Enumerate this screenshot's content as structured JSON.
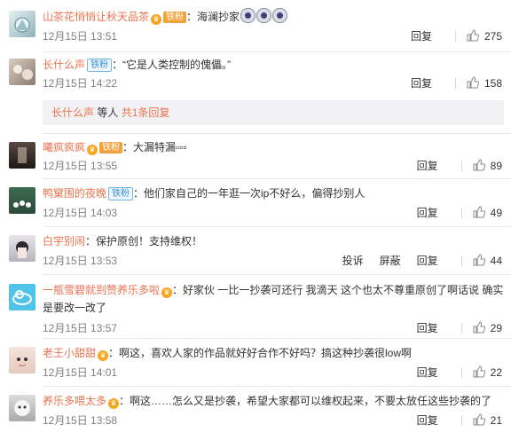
{
  "comments": [
    {
      "user": "山茶花悄悄让秋天品茶",
      "vip": "铁粉",
      "text": "：海澜抄家",
      "emoji": [
        "smiley-emoji",
        "smiley-emoji",
        "smiley-emoji"
      ],
      "time": "12月15日 13:51",
      "reply_label": "回复",
      "likes": "275"
    },
    {
      "user": "长什么声",
      "badge": "铁粉",
      "text": "：“它是人类控制的傀儡。”",
      "time": "12月15日 14:22",
      "reply_label": "回复",
      "likes": "158",
      "more_user": "长什么声",
      "more_text": " 等人 ",
      "more_count": "共1条回复"
    },
    {
      "user": "曦疯疯疯",
      "vip": "铁粉",
      "text": "：大漏特漏▫▫▫",
      "time": "12月15日 13:55",
      "reply_label": "回复",
      "likes": "89"
    },
    {
      "user": "鸭窠围的夜晚",
      "badge": "铁粉",
      "text": "：他们家自己的一年逛一次ip不好么，偏得抄别人",
      "time": "12月15日 14:03",
      "reply_label": "回复",
      "likes": "49"
    },
    {
      "user": "白宇别闹",
      "text": "：保护原创！支持维权！",
      "time": "12月15日 13:53",
      "report_label": "投诉",
      "block_label": "屏蔽",
      "reply_label": "回复",
      "likes": "44"
    },
    {
      "user": "一瓶雪碧就到赞养乐多啦",
      "text": "：好家伙 一比一抄袭可还行 我滴天 这个也太不尊重原创了啊话说 确实是要改一改了",
      "time": "12月15日 13:57",
      "reply_label": "回复",
      "likes": "29"
    },
    {
      "user": "老王小甜甜",
      "text": "：啊这，喜欢人家的作品就好好合作不好吗？搞这种抄袭很low啊",
      "time": "12月15日 14:01",
      "reply_label": "回复",
      "likes": "22"
    },
    {
      "user": "养乐多喂太多",
      "text": "：啊这……怎么又是抄袭，希望大家都可以维权起来，不要太放任这些抄袭的了",
      "time": "12月15日 13:58",
      "reply_label": "回复",
      "likes": "21"
    }
  ],
  "colors": {
    "username": "#eb7350",
    "badge_blue": "#3b8ed1",
    "vip_orange": "#f1a23a",
    "meta_gray": "#808080"
  },
  "icons": {
    "like": "thumbs-up-icon",
    "crown": "vip-crown-icon"
  }
}
